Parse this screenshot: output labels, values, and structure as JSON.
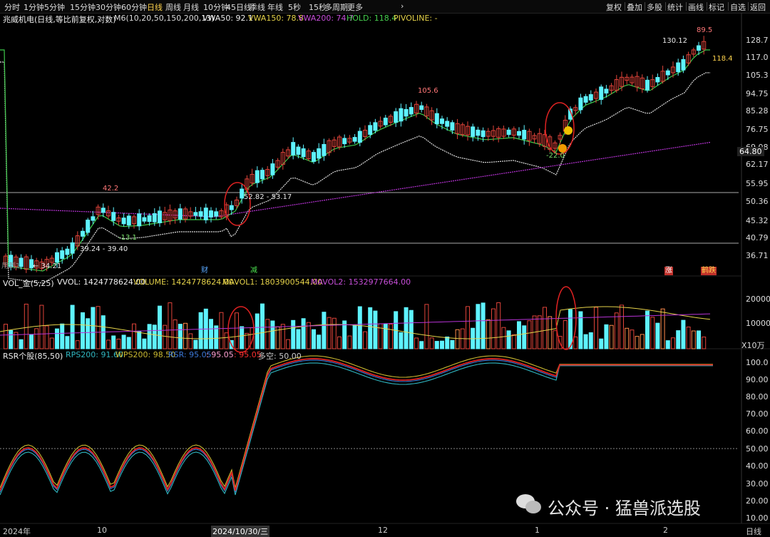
{
  "toolbar": {
    "periods": [
      "分时",
      "1分钟",
      "5分钟",
      "15分钟",
      "30分钟",
      "60分钟",
      "日线",
      "周线",
      "月线",
      "10分钟",
      "45日线",
      "季线",
      "年线",
      "5秒",
      "15秒",
      "多周期",
      "更多"
    ],
    "active": "日线",
    "right_buttons": [
      "复权",
      "叠加",
      "多股",
      "统计",
      "画线",
      "标记",
      "自选",
      "返回"
    ],
    "dropdown_arrow": "›"
  },
  "main": {
    "stock_title": "兆威机电(日线,等比前复权,对数)",
    "ma_label": "M6(10,20,50,150,200,13)",
    "vwa50": "VWA50: 92.1",
    "vwa150": "VWA150: 78.8",
    "vwa200": "VWA200: 74.7",
    "hold": "HOLD: 118.4",
    "pivot": "PIVOLINE: -",
    "price_axis": [
      "128.7",
      "117.0",
      "105.3",
      "94.75",
      "85.28",
      "76.75",
      "69.08",
      "62.17",
      "55.95",
      "50.36",
      "45.32",
      "40.79",
      "36.71"
    ],
    "current_price": "64.80",
    "annotations": {
      "high_105": "105.6",
      "high_130": "130.12",
      "high_89": "89.5",
      "hold_val": "118.4",
      "p42": "42.2",
      "m13": "-13.1",
      "m22": "-22.0",
      "range1": "52.82 - 53.17",
      "range2": "39.24 - 39.40",
      "low": "← 34.21"
    },
    "bottom_marks": [
      "财",
      "减",
      "涨",
      "鹤跌"
    ],
    "left_note": "用到1"
  },
  "volume": {
    "label": "VOL_金(5,25)",
    "vvol": "VVOL: 1424778624.00",
    "volume": "VOLUME: 1424778624.00",
    "mavol1": "MAVOL1: 1803900544.00",
    "mavol2": "MAVOL2: 1532977664.00",
    "axis": [
      "20000",
      "10000"
    ],
    "unit": "X10万"
  },
  "rsr": {
    "label": "RSR个股(85,50)",
    "rps200": "RPS200: 91.60",
    "wps200": "WPS200: 98.50",
    "rsr": "RSR: 95.05",
    "v1": ": 95.05",
    "v2": ": 95.05",
    "duokong": "多空: 50.00",
    "axis": [
      "100.0",
      "90.00",
      "80.00",
      "70.00",
      "60.00",
      "50.00",
      "40.00",
      "30.00",
      "20.00",
      "10.00"
    ]
  },
  "xaxis": {
    "labels": [
      "2024年",
      "10",
      "2024/10/30/三",
      "12",
      "1",
      "2"
    ],
    "period": "日线"
  },
  "watermark": {
    "text": "公众号 · 猛兽派选股"
  },
  "colors": {
    "up": "#e0443a",
    "down": "#5ef3ff",
    "ma_yellow": "#e6d34a",
    "ma_green": "#3ec94a",
    "vwa_white": "#dddddd",
    "vwa_purple": "#b833d6",
    "circle": "#e02222"
  }
}
